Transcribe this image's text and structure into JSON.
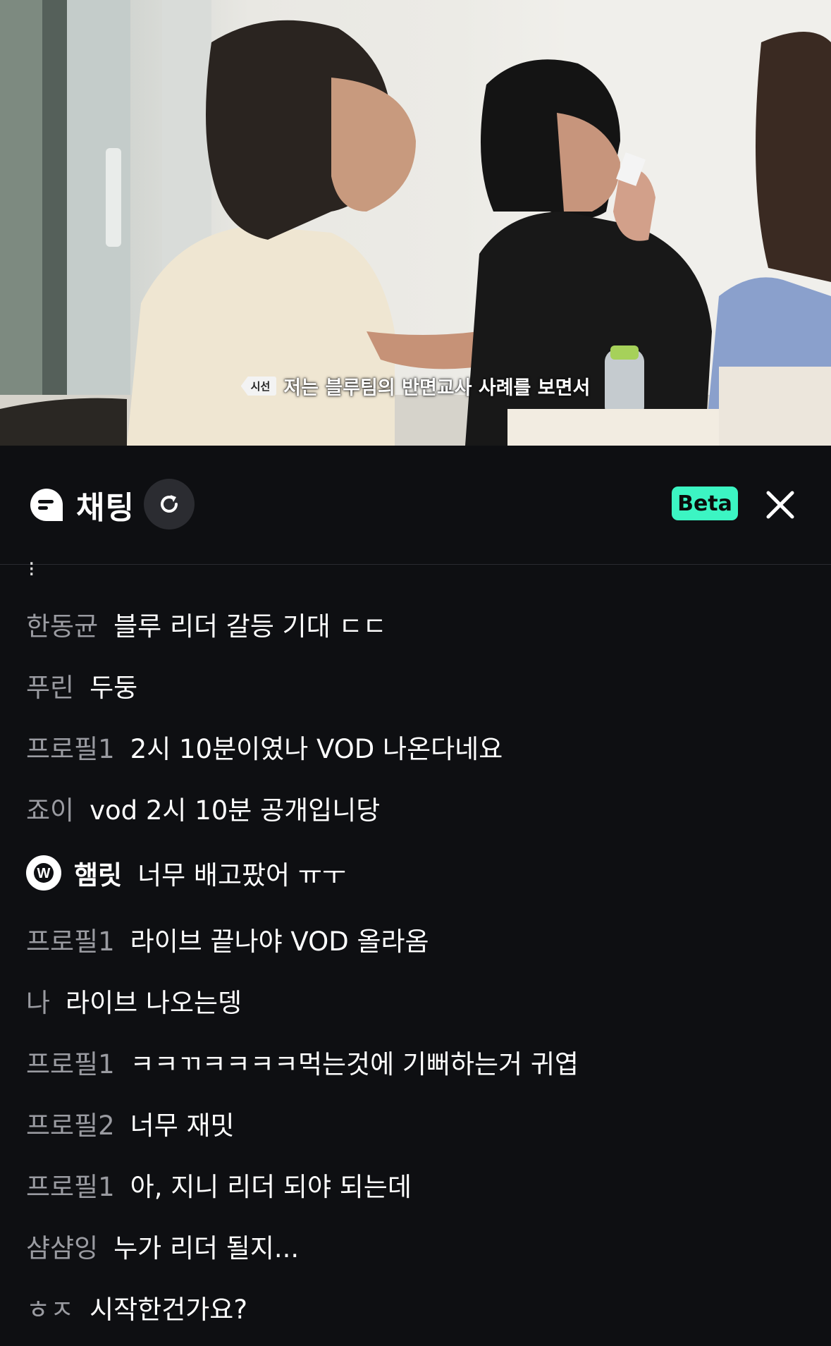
{
  "video": {
    "subtitle_badge": "시선",
    "subtitle_text": "저는 블루팀의 반면교사 사례를 보면서"
  },
  "header": {
    "logo_icon": "chat-bubble-icon",
    "title": "채팅",
    "refresh_icon": "refresh-icon",
    "beta_label": "Beta",
    "close_icon": "close-icon",
    "colors": {
      "background": "#0e0f12",
      "beta": "#3cf5c3",
      "refresh_bg": "#2b2c31"
    }
  },
  "chat": {
    "partial_top": "⁝",
    "messages": [
      {
        "nick": "한동균",
        "text": "블루 리더 갈등 기대 ㄷㄷ"
      },
      {
        "nick": "푸린",
        "text": "두둥"
      },
      {
        "nick": "프로필1",
        "text": "2시 10분이였나 VOD 나온다네요"
      },
      {
        "nick": "죠이",
        "text": "vod 2시 10분 공개입니당"
      },
      {
        "nick": "햄릿",
        "text": "너무 배고팠어 ㅠㅜ",
        "badge": "W"
      },
      {
        "nick": "프로필1",
        "text": "라이브 끝나야 VOD 올라옴"
      },
      {
        "nick": "나",
        "text": "라이브 나오는뎅"
      },
      {
        "nick": "프로필1",
        "text": "ㅋㅋㄲㅋㅋㅋㅋ먹는것에 기뻐하는거 귀엽"
      },
      {
        "nick": "프로필2",
        "text": "너무 재밋"
      },
      {
        "nick": "프로필1",
        "text": "아, 지니 리더 되야 되는데"
      },
      {
        "nick": "샴샴잉",
        "text": "누가 리더 될지..."
      },
      {
        "nick": "ㅎㅈ",
        "text": "시작한건가요?"
      }
    ]
  }
}
